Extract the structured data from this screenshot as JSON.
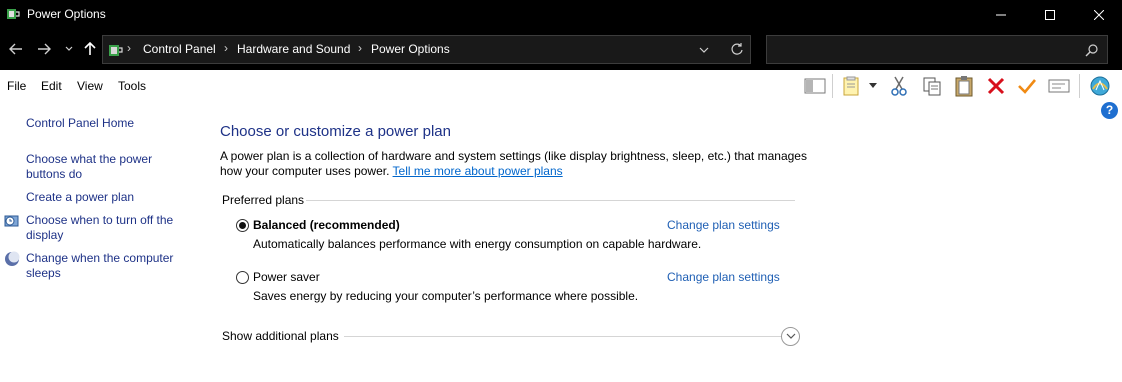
{
  "window": {
    "title": "Power Options",
    "controls": [
      "minimize",
      "maximize",
      "close"
    ]
  },
  "address": {
    "breadcrumbs": [
      "Control Panel",
      "Hardware and Sound",
      "Power Options"
    ],
    "search_placeholder": ""
  },
  "menu": {
    "items": [
      "File",
      "Edit",
      "View",
      "Tools"
    ]
  },
  "toolbar": {
    "icons": [
      "layout-icon",
      "properties-icon",
      "cut-icon",
      "copy-icon",
      "paste-icon",
      "delete-icon",
      "check-icon",
      "rename-icon",
      "shell-icon"
    ]
  },
  "sidebar": {
    "items": [
      {
        "label": "Control Panel Home"
      },
      {
        "label": "Choose what the power buttons do"
      },
      {
        "label": "Create a power plan"
      },
      {
        "label": "Choose when to turn off the display"
      },
      {
        "label": "Change when the computer sleeps"
      }
    ]
  },
  "main": {
    "heading": "Choose or customize a power plan",
    "description": "A power plan is a collection of hardware and system settings (like display brightness, sleep, etc.) that manages how your computer uses power.",
    "learn_more": "Tell me more about power plans",
    "preferred_label": "Preferred plans",
    "plans": [
      {
        "name": "Balanced (recommended)",
        "description": "Automatically balances performance with energy consumption on capable hardware.",
        "link": "Change plan settings",
        "selected": true
      },
      {
        "name": "Power saver",
        "description": "Saves energy by reducing your computer’s performance where possible.",
        "link": "Change plan settings",
        "selected": false
      }
    ],
    "show_more": "Show additional plans",
    "help": "?"
  },
  "colors": {
    "titlebar_bg": "#000000",
    "link_blue": "#1e3287",
    "plan_link_blue": "#1f5fb4",
    "help_blue": "#1f6fd0"
  }
}
